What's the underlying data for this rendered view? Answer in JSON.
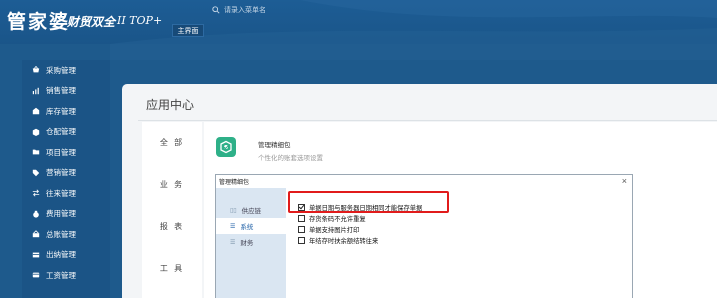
{
  "header": {
    "logo": "管家婆",
    "logo_sub": "财贸双全",
    "logo_top": "II TOP+",
    "search_placeholder": "请录入菜单名",
    "main_tab": "主界面"
  },
  "sidebar": {
    "items": [
      {
        "label": "采购管理",
        "icon": "basket-icon"
      },
      {
        "label": "销售管理",
        "icon": "chart-icon"
      },
      {
        "label": "库存管理",
        "icon": "warehouse-icon"
      },
      {
        "label": "仓配管理",
        "icon": "box-icon"
      },
      {
        "label": "项目管理",
        "icon": "folder-icon"
      },
      {
        "label": "营销管理",
        "icon": "tag-icon"
      },
      {
        "label": "往来管理",
        "icon": "transfer-icon"
      },
      {
        "label": "费用管理",
        "icon": "money-bag-icon"
      },
      {
        "label": "总账管理",
        "icon": "ledger-icon"
      },
      {
        "label": "出纳管理",
        "icon": "cash-icon"
      },
      {
        "label": "工资管理",
        "icon": "card-icon"
      }
    ]
  },
  "content": {
    "title": "应用中心",
    "categories": [
      "全 部",
      "业 务",
      "报 表",
      "工 具"
    ],
    "app": {
      "name": "管理精细包",
      "desc": "个性化的账套选项设置",
      "icon": "gear-box-icon",
      "icon_color": "#2eb088"
    }
  },
  "dialog": {
    "title": "管理精细包",
    "close": "×",
    "nav": [
      {
        "label": "供应链",
        "active": false
      },
      {
        "label": "系统",
        "active": true
      },
      {
        "label": "财务",
        "active": false
      }
    ],
    "options": [
      {
        "label": "单据日期与服务器日期相同才能保存单据",
        "checked": true
      },
      {
        "label": "存货条码不允许重复",
        "checked": false
      },
      {
        "label": "单据支持图片打印",
        "checked": false
      },
      {
        "label": "年结存时扶余额结转往来",
        "checked": false
      }
    ],
    "highlight_color": "#e11b1b"
  }
}
